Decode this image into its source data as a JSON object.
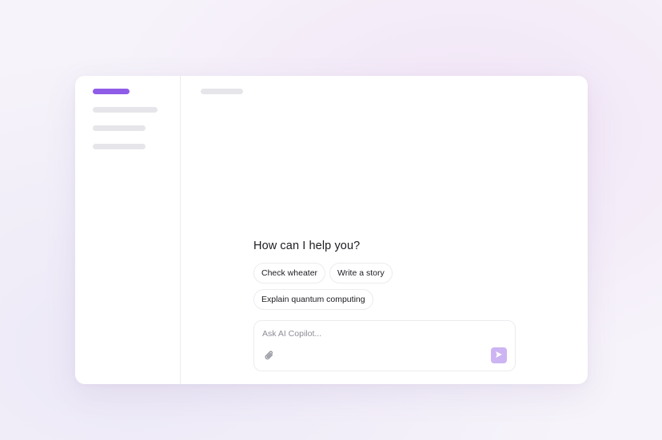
{
  "colors": {
    "accent": "#8f5ce8",
    "send_button": "#cdb4f2",
    "skeleton": "#e6e6ea",
    "text": "#1c1c22"
  },
  "main": {
    "heading": "How can I help you?",
    "suggestions": [
      {
        "label": "Check wheater"
      },
      {
        "label": "Write a story"
      },
      {
        "label": "Explain quantum computing"
      }
    ],
    "composer": {
      "placeholder": "Ask AI Copilot...",
      "attach_icon": "paperclip-icon",
      "send_icon": "send-icon"
    }
  }
}
